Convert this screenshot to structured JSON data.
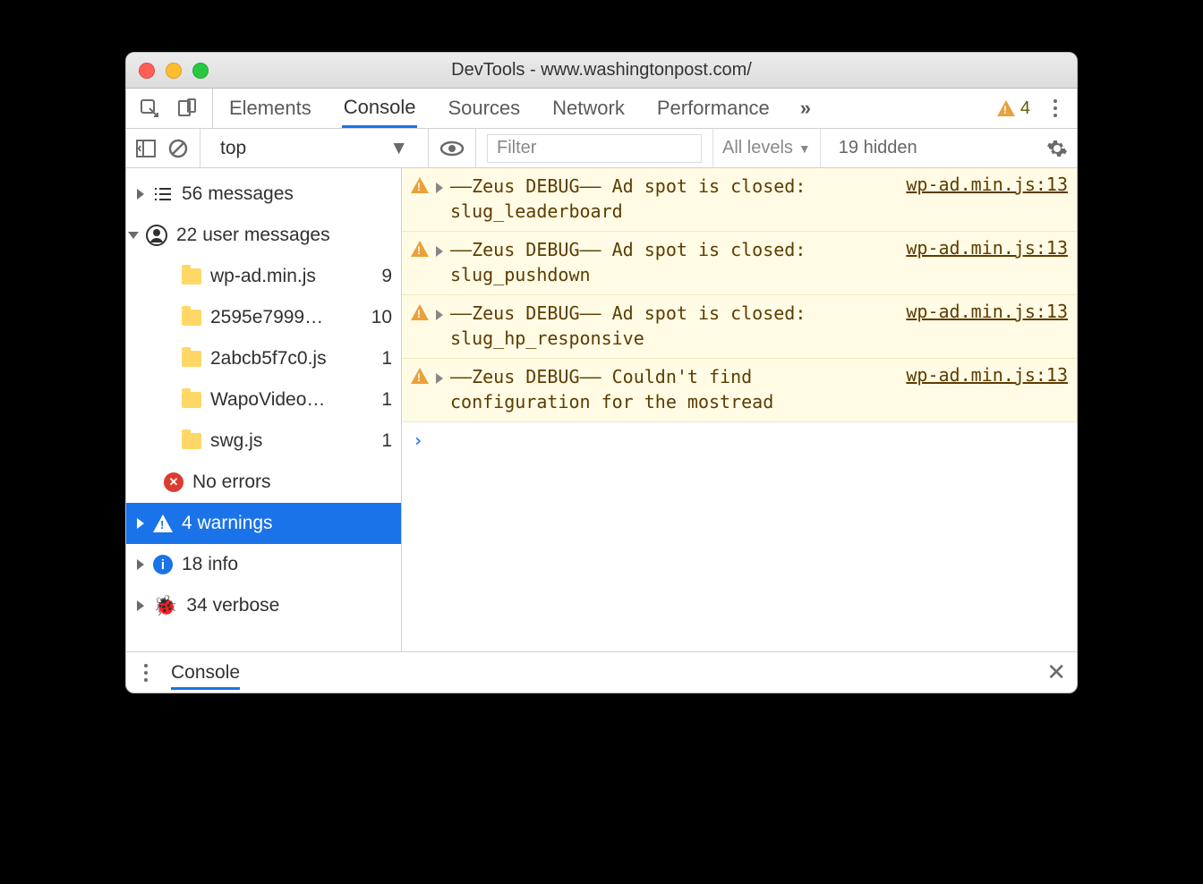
{
  "window": {
    "title": "DevTools - www.washingtonpost.com/"
  },
  "tabs": {
    "elements": "Elements",
    "console": "Console",
    "sources": "Sources",
    "network": "Network",
    "performance": "Performance",
    "warn_count": "4"
  },
  "toolbar": {
    "context": "top",
    "filter_placeholder": "Filter",
    "levels": "All levels",
    "hidden": "19 hidden"
  },
  "sidebar": {
    "messages": {
      "label": "56 messages"
    },
    "user_messages": {
      "label": "22 user messages"
    },
    "files": [
      {
        "name": "wp-ad.min.js",
        "count": "9"
      },
      {
        "name": "2595e7999…",
        "count": "10"
      },
      {
        "name": "2abcb5f7c0.js",
        "count": "1"
      },
      {
        "name": "WapoVideo…",
        "count": "1"
      },
      {
        "name": "swg.js",
        "count": "1"
      }
    ],
    "no_errors": "No errors",
    "warnings": "4 warnings",
    "info": "18 info",
    "verbose": "34 verbose"
  },
  "logs": [
    {
      "msg": "——Zeus DEBUG—— Ad spot is closed: slug_leaderboard",
      "src": "wp-ad.min.js:13"
    },
    {
      "msg": "——Zeus DEBUG—— Ad spot is closed: slug_pushdown",
      "src": "wp-ad.min.js:13"
    },
    {
      "msg": "——Zeus DEBUG—— Ad spot is closed: slug_hp_responsive",
      "src": "wp-ad.min.js:13"
    },
    {
      "msg": "——Zeus DEBUG—— Couldn't find configuration for the mostread",
      "src": "wp-ad.min.js:13"
    }
  ],
  "drawer": {
    "tab": "Console"
  }
}
